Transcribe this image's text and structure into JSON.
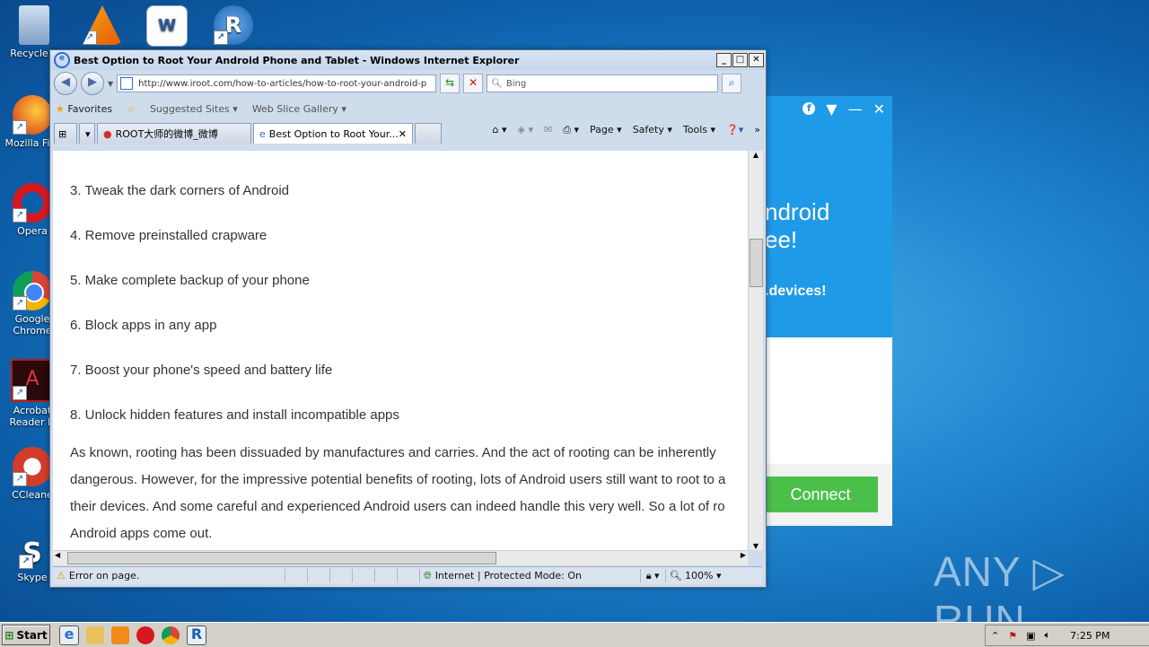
{
  "desktop": {
    "icons": [
      {
        "label": "Recycle B",
        "name": "recycle-bin-icon",
        "color": "#9bb8d6"
      },
      {
        "label": "Mozilla Fire",
        "name": "firefox-icon",
        "color": "#e8742a"
      },
      {
        "label": "Opera",
        "name": "opera-icon",
        "color": "#d7181e"
      },
      {
        "label": "Google Chrome",
        "name": "chrome-icon",
        "color": "#3aa757"
      },
      {
        "label": "Acrobat Reader D",
        "name": "acrobat-icon",
        "color": "#b31b1b"
      },
      {
        "label": "CCleane",
        "name": "ccleaner-icon",
        "color": "#d23c2a"
      },
      {
        "label": "Skype",
        "name": "skype-icon",
        "color": "#16a3e4"
      }
    ]
  },
  "popup": {
    "line1": "ndroid",
    "line2": "ee!",
    "line3": ".devices!",
    "connect": "Connect",
    "bg_color": "#1f9ae6",
    "button_color": "#4cbf4a"
  },
  "browser": {
    "title": "Best Option to Root Your Android Phone and Tablet - Windows Internet Explorer",
    "url": "http://www.iroot.com/how-to-articles/how-to-root-your-android-p",
    "search_placeholder": "Bing",
    "favorites": "Favorites",
    "suggested_sites": "Suggested Sites",
    "web_slice_gallery": "Web Slice Gallery",
    "tabs": [
      {
        "label": "ROOT大师的微博_微博"
      },
      {
        "label": "Best Option to Root Your..."
      }
    ],
    "commands": {
      "page": "Page",
      "safety": "Safety",
      "tools": "Tools"
    },
    "content": {
      "items": [
        "3. Tweak the dark corners of Android",
        "4. Remove preinstalled crapware",
        "5. Make complete backup of your phone",
        "6. Block apps in any app",
        "7. Boost your phone's speed and battery life",
        "8. Unlock hidden features and install incompatible apps"
      ],
      "paragraph_lines": [
        "As known, rooting has been dissuaded by manufactures and carries. And the act of rooting can be inherently",
        "dangerous. However, for the impressive potential benefits of rooting, lots of Android users still want to root to a",
        "their devices. And some careful and experienced Android users can indeed handle this very well. So a lot of ro",
        "Android apps come out."
      ]
    },
    "status": {
      "error": "Error on page.",
      "zone": "Internet | Protected Mode: On",
      "zoom": "100%"
    }
  },
  "taskbar": {
    "start": "Start",
    "time": "7:25 PM"
  },
  "watermark": "ANY ▷ RUN"
}
